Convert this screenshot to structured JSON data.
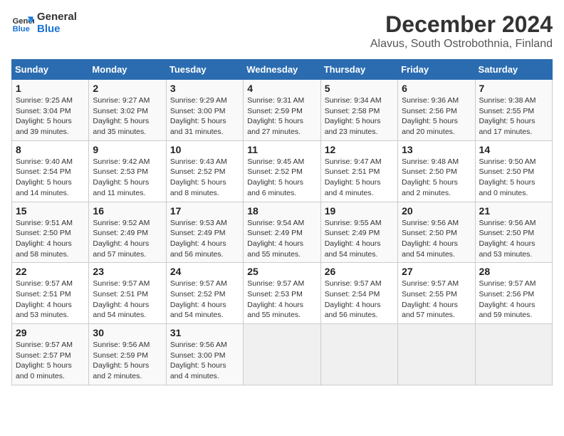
{
  "logo": {
    "line1": "General",
    "line2": "Blue"
  },
  "title": "December 2024",
  "subtitle": "Alavus, South Ostrobothnia, Finland",
  "days_of_week": [
    "Sunday",
    "Monday",
    "Tuesday",
    "Wednesday",
    "Thursday",
    "Friday",
    "Saturday"
  ],
  "weeks": [
    [
      {
        "day": 1,
        "info": "Sunrise: 9:25 AM\nSunset: 3:04 PM\nDaylight: 5 hours\nand 39 minutes."
      },
      {
        "day": 2,
        "info": "Sunrise: 9:27 AM\nSunset: 3:02 PM\nDaylight: 5 hours\nand 35 minutes."
      },
      {
        "day": 3,
        "info": "Sunrise: 9:29 AM\nSunset: 3:00 PM\nDaylight: 5 hours\nand 31 minutes."
      },
      {
        "day": 4,
        "info": "Sunrise: 9:31 AM\nSunset: 2:59 PM\nDaylight: 5 hours\nand 27 minutes."
      },
      {
        "day": 5,
        "info": "Sunrise: 9:34 AM\nSunset: 2:58 PM\nDaylight: 5 hours\nand 23 minutes."
      },
      {
        "day": 6,
        "info": "Sunrise: 9:36 AM\nSunset: 2:56 PM\nDaylight: 5 hours\nand 20 minutes."
      },
      {
        "day": 7,
        "info": "Sunrise: 9:38 AM\nSunset: 2:55 PM\nDaylight: 5 hours\nand 17 minutes."
      }
    ],
    [
      {
        "day": 8,
        "info": "Sunrise: 9:40 AM\nSunset: 2:54 PM\nDaylight: 5 hours\nand 14 minutes."
      },
      {
        "day": 9,
        "info": "Sunrise: 9:42 AM\nSunset: 2:53 PM\nDaylight: 5 hours\nand 11 minutes."
      },
      {
        "day": 10,
        "info": "Sunrise: 9:43 AM\nSunset: 2:52 PM\nDaylight: 5 hours\nand 8 minutes."
      },
      {
        "day": 11,
        "info": "Sunrise: 9:45 AM\nSunset: 2:52 PM\nDaylight: 5 hours\nand 6 minutes."
      },
      {
        "day": 12,
        "info": "Sunrise: 9:47 AM\nSunset: 2:51 PM\nDaylight: 5 hours\nand 4 minutes."
      },
      {
        "day": 13,
        "info": "Sunrise: 9:48 AM\nSunset: 2:50 PM\nDaylight: 5 hours\nand 2 minutes."
      },
      {
        "day": 14,
        "info": "Sunrise: 9:50 AM\nSunset: 2:50 PM\nDaylight: 5 hours\nand 0 minutes."
      }
    ],
    [
      {
        "day": 15,
        "info": "Sunrise: 9:51 AM\nSunset: 2:50 PM\nDaylight: 4 hours\nand 58 minutes."
      },
      {
        "day": 16,
        "info": "Sunrise: 9:52 AM\nSunset: 2:49 PM\nDaylight: 4 hours\nand 57 minutes."
      },
      {
        "day": 17,
        "info": "Sunrise: 9:53 AM\nSunset: 2:49 PM\nDaylight: 4 hours\nand 56 minutes."
      },
      {
        "day": 18,
        "info": "Sunrise: 9:54 AM\nSunset: 2:49 PM\nDaylight: 4 hours\nand 55 minutes."
      },
      {
        "day": 19,
        "info": "Sunrise: 9:55 AM\nSunset: 2:49 PM\nDaylight: 4 hours\nand 54 minutes."
      },
      {
        "day": 20,
        "info": "Sunrise: 9:56 AM\nSunset: 2:50 PM\nDaylight: 4 hours\nand 54 minutes."
      },
      {
        "day": 21,
        "info": "Sunrise: 9:56 AM\nSunset: 2:50 PM\nDaylight: 4 hours\nand 53 minutes."
      }
    ],
    [
      {
        "day": 22,
        "info": "Sunrise: 9:57 AM\nSunset: 2:51 PM\nDaylight: 4 hours\nand 53 minutes."
      },
      {
        "day": 23,
        "info": "Sunrise: 9:57 AM\nSunset: 2:51 PM\nDaylight: 4 hours\nand 54 minutes."
      },
      {
        "day": 24,
        "info": "Sunrise: 9:57 AM\nSunset: 2:52 PM\nDaylight: 4 hours\nand 54 minutes."
      },
      {
        "day": 25,
        "info": "Sunrise: 9:57 AM\nSunset: 2:53 PM\nDaylight: 4 hours\nand 55 minutes."
      },
      {
        "day": 26,
        "info": "Sunrise: 9:57 AM\nSunset: 2:54 PM\nDaylight: 4 hours\nand 56 minutes."
      },
      {
        "day": 27,
        "info": "Sunrise: 9:57 AM\nSunset: 2:55 PM\nDaylight: 4 hours\nand 57 minutes."
      },
      {
        "day": 28,
        "info": "Sunrise: 9:57 AM\nSunset: 2:56 PM\nDaylight: 4 hours\nand 59 minutes."
      }
    ],
    [
      {
        "day": 29,
        "info": "Sunrise: 9:57 AM\nSunset: 2:57 PM\nDaylight: 5 hours\nand 0 minutes."
      },
      {
        "day": 30,
        "info": "Sunrise: 9:56 AM\nSunset: 2:59 PM\nDaylight: 5 hours\nand 2 minutes."
      },
      {
        "day": 31,
        "info": "Sunrise: 9:56 AM\nSunset: 3:00 PM\nDaylight: 5 hours\nand 4 minutes."
      },
      null,
      null,
      null,
      null
    ]
  ]
}
